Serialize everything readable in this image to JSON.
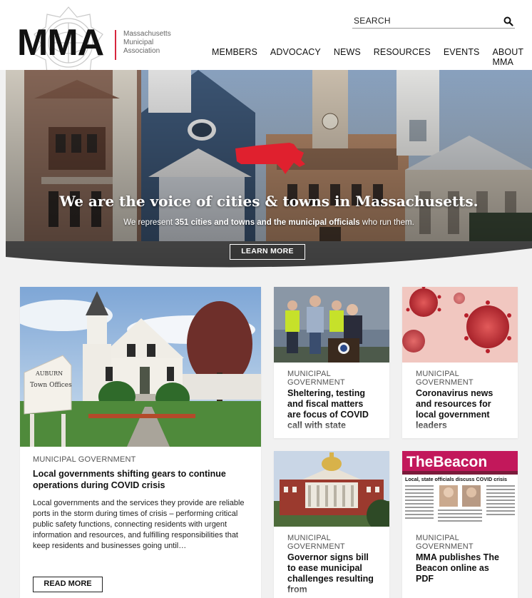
{
  "header": {
    "logo_text": "MMA",
    "logo_sub": [
      "Massachusetts",
      "Municipal",
      "Association"
    ],
    "search_placeholder": "SEARCH",
    "nav": [
      "MEMBERS",
      "ADVOCACY",
      "NEWS",
      "RESOURCES",
      "EVENTS",
      "ABOUT MMA"
    ]
  },
  "hero": {
    "title": "We are the voice of cities & towns in Massachusetts.",
    "sub_pre": "We represent",
    "sub_bold": "351 cities and towns and the municipal officials",
    "sub_post": "who run them.",
    "button": "LEARN MORE"
  },
  "cards": {
    "main": {
      "category": "MUNICIPAL GOVERNMENT",
      "title": "Local governments shifting gears to continue operations during COVID crisis",
      "excerpt": "Local governments and the services they provide are reliable ports in the storm during times of crisis – performing critical public safety functions, connecting residents with urgent information and resources, and fulfilling responsibilities that keep residents and businesses going until…",
      "button": "READ MORE",
      "sign_text": "AUBURN Town Offices"
    },
    "c1": {
      "category": "MUNICIPAL GOVERNMENT",
      "title": "Sheltering, testing and fiscal matters are focus of COVID call with state"
    },
    "c2": {
      "category": "MUNICIPAL GOVERNMENT",
      "title": "Coronavirus news and resources for local government leaders"
    },
    "c3": {
      "category": "MUNICIPAL GOVERNMENT",
      "title": "Governor signs bill to ease municipal challenges resulting from"
    },
    "c4": {
      "category": "MUNICIPAL GOVERNMENT",
      "title": "MMA publishes The Beacon online as PDF",
      "beacon_masthead": "TheBeacon",
      "beacon_headline": "Local, state officials discuss COVID crisis"
    }
  },
  "colors": {
    "accent_red": "#d7263d",
    "beacon_pink": "#c2185b"
  }
}
